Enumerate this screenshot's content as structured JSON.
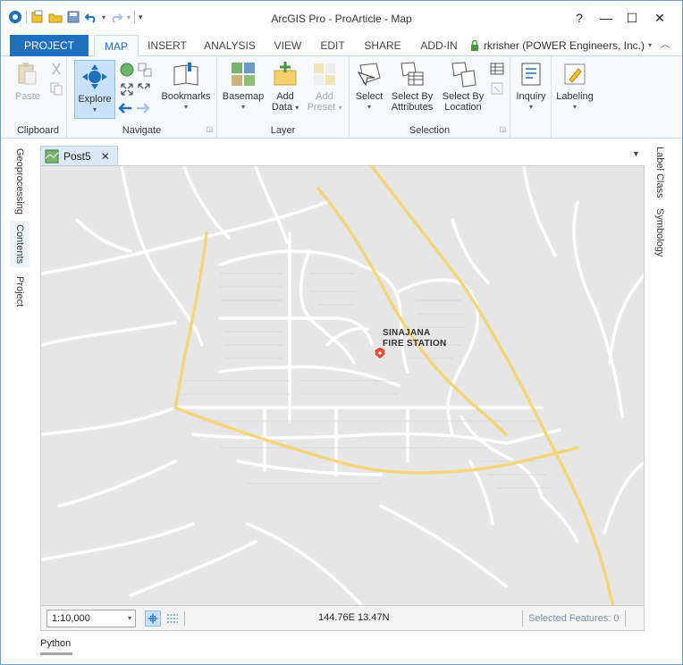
{
  "window": {
    "title": "ArcGIS Pro - ProArticle - Map",
    "help": "?",
    "minimize": "—",
    "maximize": "☐",
    "close": "✕"
  },
  "tabs": [
    {
      "label": "PROJECT"
    },
    {
      "label": "MAP"
    },
    {
      "label": "INSERT"
    },
    {
      "label": "ANALYSIS"
    },
    {
      "label": "VIEW"
    },
    {
      "label": "EDIT"
    },
    {
      "label": "SHARE"
    },
    {
      "label": "ADD-IN"
    }
  ],
  "user": {
    "name": "rkrisher (POWER Engineers, Inc.)",
    "caret": "▾",
    "collapse": "︿"
  },
  "ribbon": {
    "clipboard": {
      "label": "Clipboard",
      "paste": "Paste"
    },
    "navigate": {
      "label": "Navigate",
      "explore": "Explore",
      "bookmarks": "Bookmarks"
    },
    "layer": {
      "label": "Layer",
      "basemap": "Basemap",
      "add_data_1": "Add",
      "add_data_2": "Data",
      "add_preset_1": "Add",
      "add_preset_2": "Preset"
    },
    "selection": {
      "label": "Selection",
      "select": "Select",
      "by_attr_1": "Select By",
      "by_attr_2": "Attributes",
      "by_loc_1": "Select By",
      "by_loc_2": "Location"
    },
    "inquiry": "Inquiry",
    "labeling": "Labeling"
  },
  "left_panes": [
    "Geoprocessing",
    "Contents",
    "Project"
  ],
  "right_panes": [
    "Label Class",
    "Symbology"
  ],
  "map_tab": {
    "name": "Post5",
    "close": "✕"
  },
  "map": {
    "label_line1": "SINAJANA",
    "label_line2": "FIRE STATION"
  },
  "status": {
    "scale": "1:10,000",
    "coordinates": "144.76E 13.47N",
    "selected": "Selected Features: 0"
  },
  "bottom_tab": "Python",
  "colors": {
    "accent": "#1f6fbf",
    "road_major": "#f4d57a",
    "road_minor": "#ffffff",
    "map_bg": "#e6e6e6"
  }
}
